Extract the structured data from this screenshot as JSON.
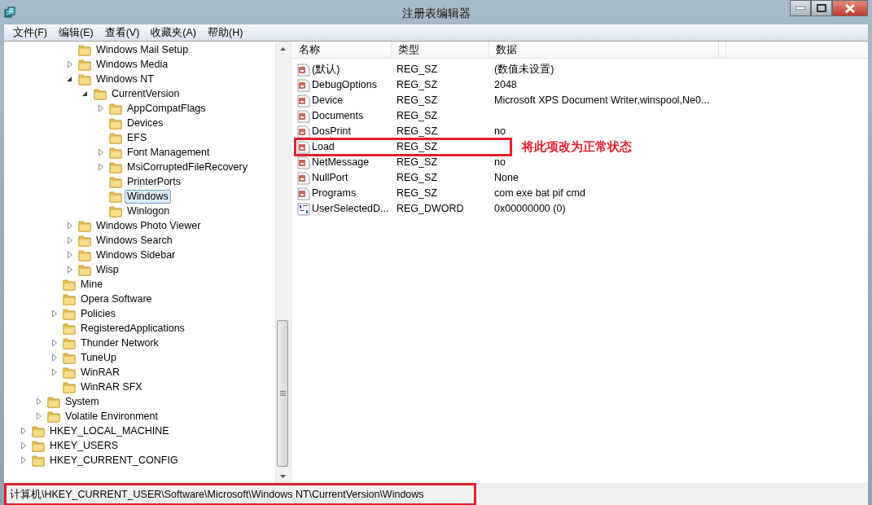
{
  "window": {
    "title": "注册表编辑器"
  },
  "menu": [
    "文件(F)",
    "编辑(E)",
    "查看(V)",
    "收藏夹(A)",
    "帮助(H)"
  ],
  "tree": [
    {
      "children": [
        {
          "children": [
            {
              "children": [
                {
                  "children": [
                    {
                      "label": "Windows Mail Setup",
                      "selected": false
                    },
                    {
                      "label": "Windows Media",
                      "expanded": false,
                      "selected": false
                    },
                    {
                      "label": "Windows NT",
                      "expanded": true,
                      "selected": false,
                      "children": [
                        {
                          "label": "CurrentVersion",
                          "expanded": true,
                          "selected": false,
                          "children": [
                            {
                              "label": "AppCompatFlags",
                              "expanded": false,
                              "selected": false
                            },
                            {
                              "label": "Devices",
                              "selected": false
                            },
                            {
                              "label": "EFS",
                              "selected": false
                            },
                            {
                              "label": "Font Management",
                              "expanded": false,
                              "selected": false
                            },
                            {
                              "label": "MsiCorruptedFileRecovery",
                              "expanded": false,
                              "selected": false
                            },
                            {
                              "label": "PrinterPorts",
                              "selected": false
                            },
                            {
                              "label": "Windows",
                              "selected": true
                            },
                            {
                              "label": "Winlogon",
                              "selected": false
                            }
                          ]
                        }
                      ]
                    },
                    {
                      "label": "Windows Photo Viewer",
                      "expanded": false,
                      "selected": false
                    },
                    {
                      "label": "Windows Search",
                      "expanded": false,
                      "selected": false
                    },
                    {
                      "label": "Windows Sidebar",
                      "expanded": false,
                      "selected": false
                    },
                    {
                      "label": "Wisp",
                      "expanded": false,
                      "selected": false
                    }
                  ]
                },
                {
                  "label": "Mine",
                  "selected": false
                },
                {
                  "label": "Opera Software",
                  "selected": false
                },
                {
                  "label": "Policies",
                  "expanded": false,
                  "selected": false
                },
                {
                  "label": "RegisteredApplications",
                  "selected": false
                },
                {
                  "label": "Thunder Network",
                  "expanded": false,
                  "selected": false
                },
                {
                  "label": "TuneUp",
                  "expanded": false,
                  "selected": false
                },
                {
                  "label": "WinRAR",
                  "expanded": false,
                  "selected": false
                },
                {
                  "label": "WinRAR SFX",
                  "selected": false
                }
              ]
            },
            {
              "label": "System",
              "expanded": false,
              "selected": false
            },
            {
              "label": "Volatile Environment",
              "expanded": false,
              "selected": false
            }
          ]
        },
        {
          "label": "HKEY_LOCAL_MACHINE",
          "expanded": false,
          "selected": false
        },
        {
          "label": "HKEY_USERS",
          "expanded": false,
          "selected": false
        },
        {
          "label": "HKEY_CURRENT_CONFIG",
          "expanded": false,
          "selected": false
        }
      ]
    }
  ],
  "values": {
    "columns": [
      "名称",
      "类型",
      "数据"
    ],
    "rows": [
      {
        "kind": "string",
        "name": "(默认)",
        "type": "REG_SZ",
        "data": "(数值未设置)",
        "outlined": false
      },
      {
        "kind": "string",
        "name": "DebugOptions",
        "type": "REG_SZ",
        "data": "2048",
        "outlined": false
      },
      {
        "kind": "string",
        "name": "Device",
        "type": "REG_SZ",
        "data": "Microsoft XPS Document Writer,winspool,Ne0...",
        "outlined": false
      },
      {
        "kind": "string",
        "name": "Documents",
        "type": "REG_SZ",
        "data": "",
        "outlined": false
      },
      {
        "kind": "string",
        "name": "DosPrint",
        "type": "REG_SZ",
        "data": "no",
        "outlined": false
      },
      {
        "kind": "string",
        "name": "Load",
        "type": "REG_SZ",
        "data": "",
        "outlined": true,
        "note": "将此项改为正常状态"
      },
      {
        "kind": "string",
        "name": "NetMessage",
        "type": "REG_SZ",
        "data": "no",
        "outlined": false
      },
      {
        "kind": "string",
        "name": "NullPort",
        "type": "REG_SZ",
        "data": "None",
        "outlined": false
      },
      {
        "kind": "string",
        "name": "Programs",
        "type": "REG_SZ",
        "data": "com exe bat pif cmd",
        "outlined": false
      },
      {
        "kind": "dword",
        "name": "UserSelectedD...",
        "type": "REG_DWORD",
        "data": "0x00000000 (0)",
        "outlined": false
      }
    ]
  },
  "status_bar": {
    "text": "计算机\\HKEY_CURRENT_USER\\Software\\Microsoft\\Windows NT\\CurrentVersion\\Windows",
    "outlined": true
  }
}
